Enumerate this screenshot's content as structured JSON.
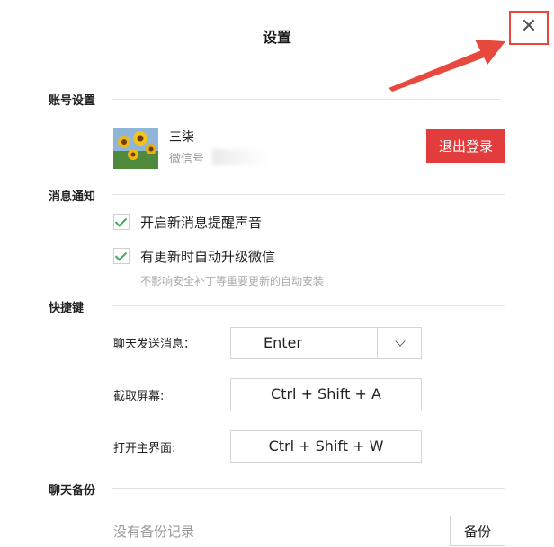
{
  "window": {
    "title": "设置",
    "close_glyph": "✕"
  },
  "account": {
    "section_label": "账号设置",
    "nickname": "三柒",
    "wechat_id_label": "微信号",
    "logout_label": "退出登录"
  },
  "notifications": {
    "section_label": "消息通知",
    "options": [
      {
        "label": "开启新消息提醒声音",
        "checked": true
      },
      {
        "label": "有更新时自动升级微信",
        "checked": true
      }
    ],
    "hint": "不影响安全补丁等重要更新的自动安装"
  },
  "shortcuts": {
    "section_label": "快捷键",
    "rows": [
      {
        "label": "聊天发送消息：",
        "value": "Enter",
        "dropdown": true
      },
      {
        "label": "截取屏幕:",
        "value": "Ctrl + Shift + A"
      },
      {
        "label": "打开主界面:",
        "value": "Ctrl + Shift + W"
      }
    ]
  },
  "backup": {
    "section_label": "聊天备份",
    "empty_text": "没有备份记录",
    "button_label": "备份"
  },
  "colors": {
    "accent_red": "#e23c3c",
    "annotation_red": "#e8493f",
    "check_green": "#3daa5a"
  }
}
